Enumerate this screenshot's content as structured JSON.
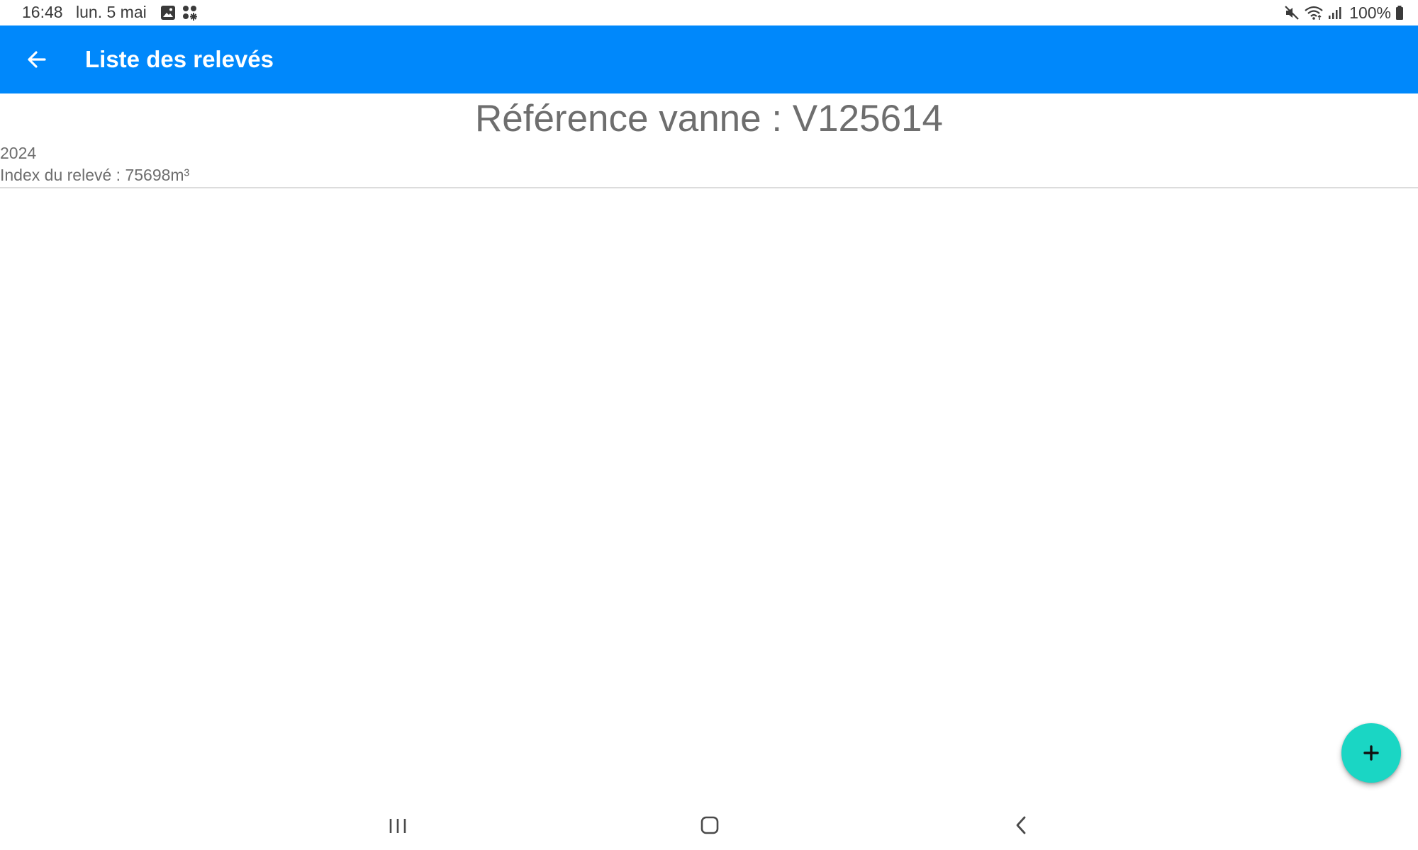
{
  "status_bar": {
    "time": "16:48",
    "date": "lun. 5 mai",
    "battery": "100%",
    "icons": [
      "gallery-icon",
      "apps-icon",
      "mute-icon",
      "wifi-icon",
      "signal-icon",
      "battery-icon"
    ]
  },
  "app_bar": {
    "title": "Liste des relevés",
    "back_icon": "arrow-left-icon",
    "color": "#0088fb"
  },
  "main": {
    "reference": "Référence vanne : V125614",
    "releves": [
      {
        "year": "2024",
        "index": "Index du relevé : 75698m³"
      }
    ]
  },
  "fab": {
    "icon": "plus-icon",
    "color": "#1ad6c4"
  },
  "nav_bar": {
    "icons": [
      "recents-icon",
      "home-icon",
      "back-icon"
    ]
  }
}
